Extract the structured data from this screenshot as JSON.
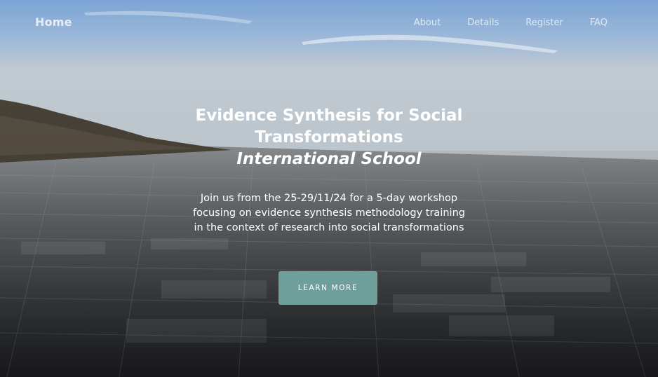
{
  "nav": {
    "brand": "Home",
    "links": [
      {
        "label": "About"
      },
      {
        "label": "Details"
      },
      {
        "label": "Register"
      },
      {
        "label": "FAQ"
      }
    ]
  },
  "hero": {
    "title_line1": "Evidence Synthesis for Social",
    "title_line2": "Transformations",
    "title_line3": "International School",
    "description": "Join us from the 25-29/11/24 for a 5-day workshop focusing on evidence synthesis methodology training in the context of research into social transformations",
    "cta_label": "LEARN MORE"
  },
  "colors": {
    "cta_background": "#6f9f9a",
    "text": "#ffffff",
    "sky_top": "#7fa6d4"
  }
}
